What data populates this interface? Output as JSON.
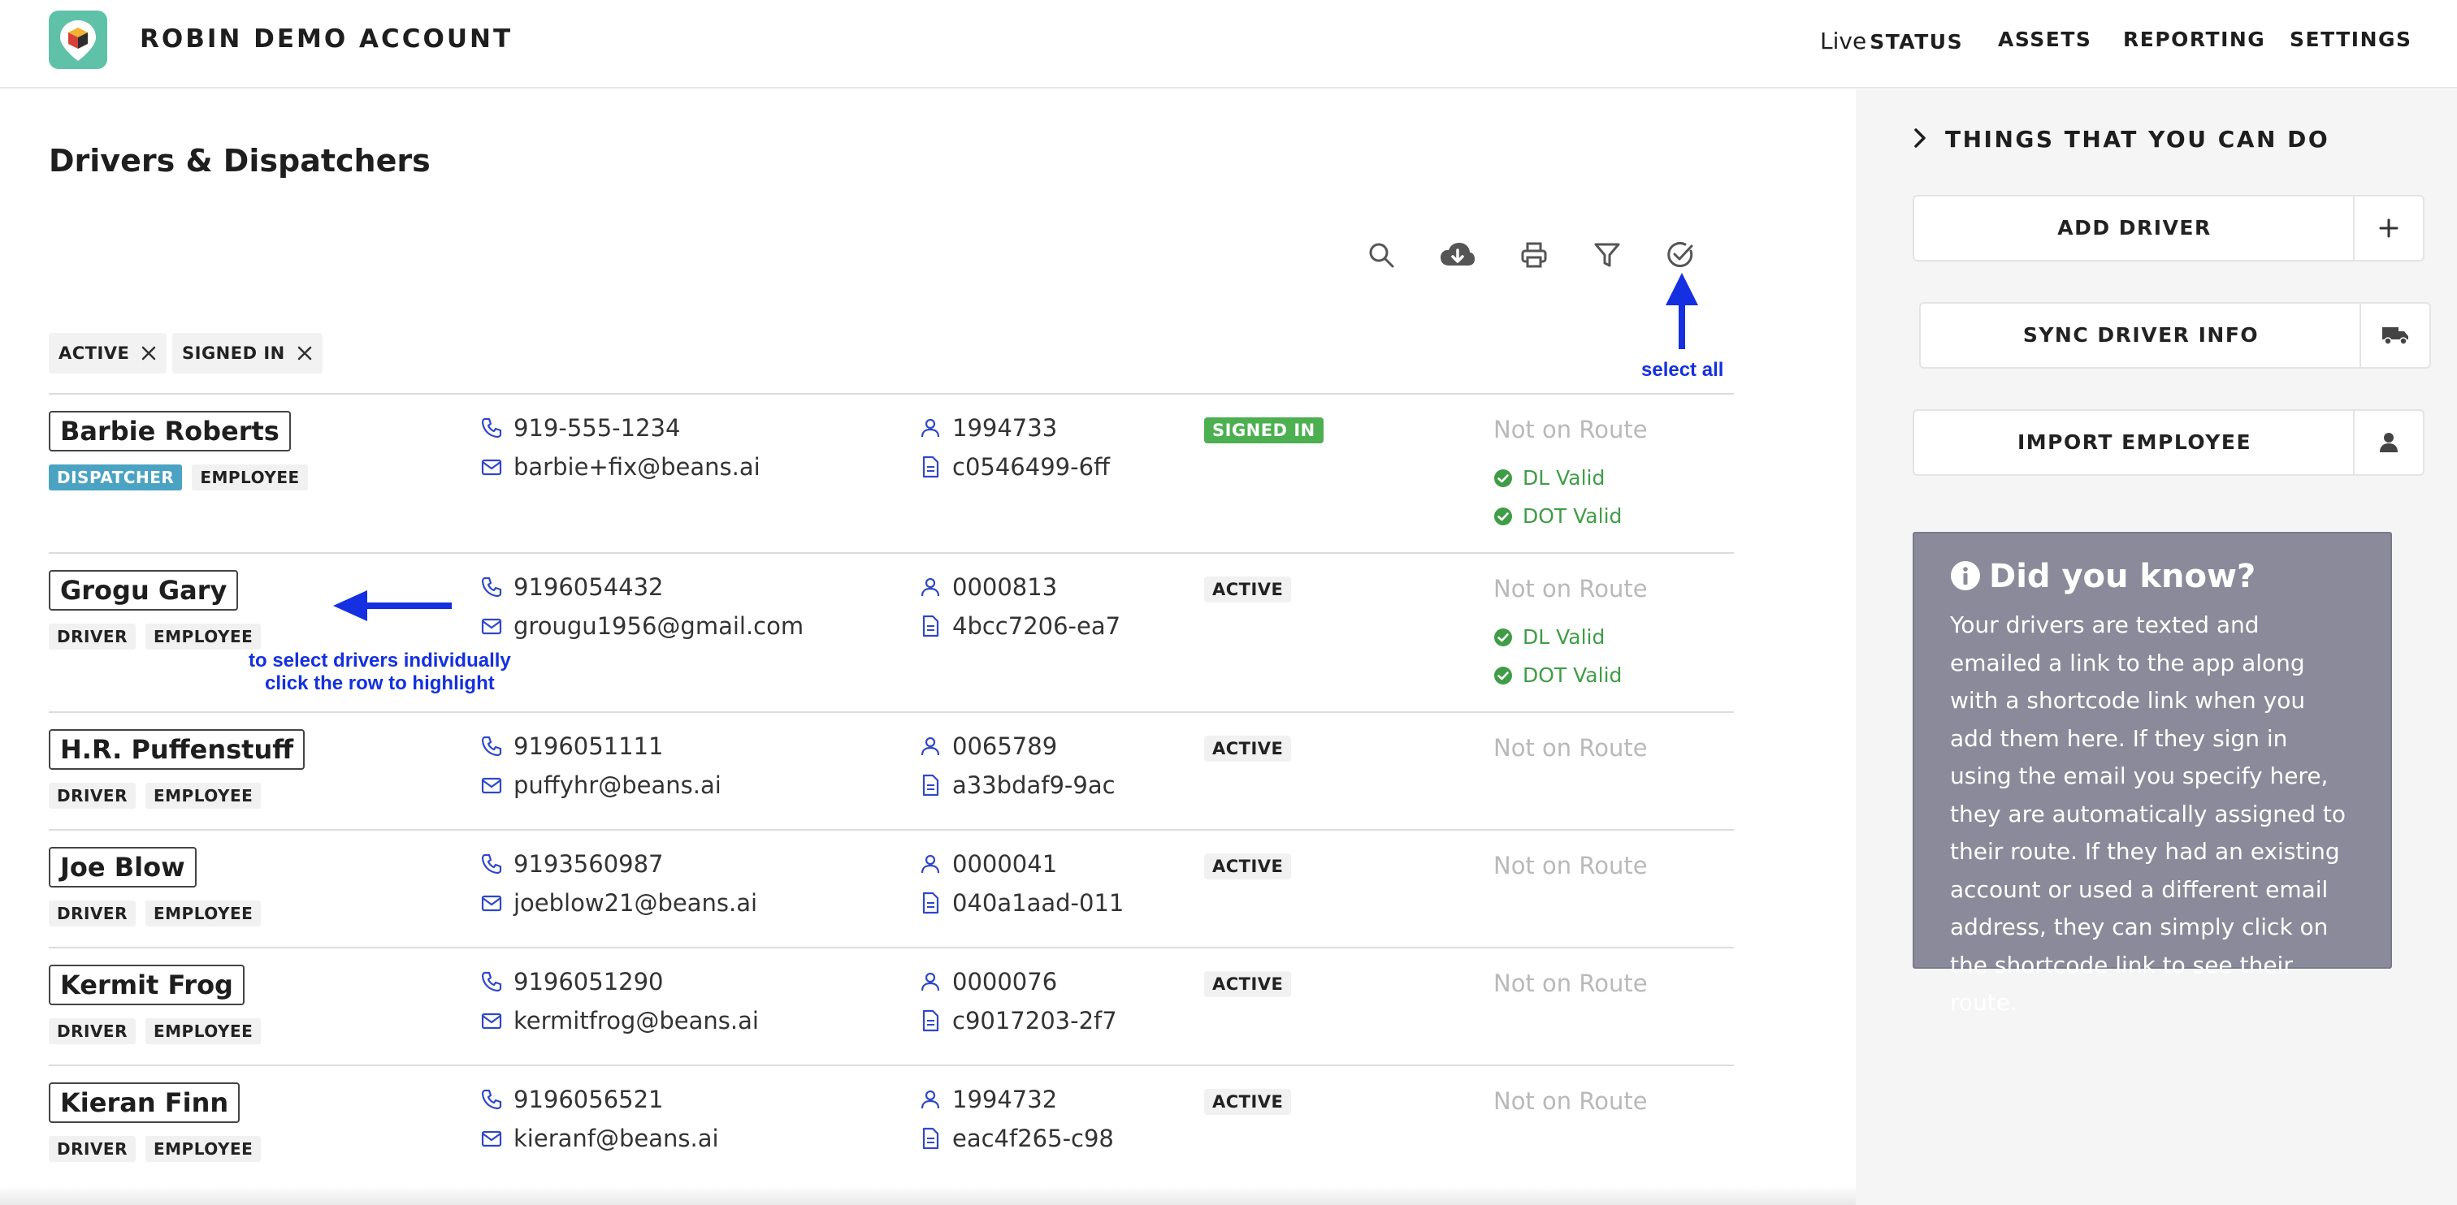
{
  "header": {
    "brand": "ROBIN DEMO ACCOUNT",
    "nav": [
      {
        "prefix": "Live",
        "label": "STATUS"
      },
      {
        "prefix": "",
        "label": "ASSETS"
      },
      {
        "prefix": "",
        "label": "REPORTING"
      },
      {
        "prefix": "",
        "label": "SETTINGS"
      }
    ]
  },
  "main": {
    "title": "Drivers & Dispatchers",
    "toolbar": [
      "search-icon",
      "cloud-download-icon",
      "print-icon",
      "filter-icon",
      "check-circle-icon"
    ],
    "filters": [
      "ACTIVE",
      "SIGNED IN"
    ],
    "annotations": {
      "select_all": "select all",
      "individual_line1": "to select drivers individually",
      "individual_line2": "click the row to highlight"
    },
    "drivers": [
      {
        "name": "Barbie Roberts",
        "tags": [
          "DISPATCHER",
          "EMPLOYEE"
        ],
        "phone": "919-555-1234",
        "email": "barbie+fix@beans.ai",
        "employee_id": "1994733",
        "doc_id": "c0546499-6ff",
        "status": "SIGNED IN",
        "route": "Not on Route",
        "valid": [
          "DL Valid",
          "DOT Valid"
        ]
      },
      {
        "name": "Grogu Gary",
        "tags": [
          "DRIVER",
          "EMPLOYEE"
        ],
        "phone": "9196054432",
        "email": "grougu1956@gmail.com",
        "employee_id": "0000813",
        "doc_id": "4bcc7206-ea7",
        "status": "ACTIVE",
        "route": "Not on Route",
        "valid": [
          "DL Valid",
          "DOT Valid"
        ]
      },
      {
        "name": "H.R. Puffenstuff",
        "tags": [
          "DRIVER",
          "EMPLOYEE"
        ],
        "phone": "9196051111",
        "email": "puffyhr@beans.ai",
        "employee_id": "0065789",
        "doc_id": "a33bdaf9-9ac",
        "status": "ACTIVE",
        "route": "Not on Route",
        "valid": []
      },
      {
        "name": "Joe Blow",
        "tags": [
          "DRIVER",
          "EMPLOYEE"
        ],
        "phone": "9193560987",
        "email": "joeblow21@beans.ai",
        "employee_id": "0000041",
        "doc_id": "040a1aad-011",
        "status": "ACTIVE",
        "route": "Not on Route",
        "valid": []
      },
      {
        "name": "Kermit Frog",
        "tags": [
          "DRIVER",
          "EMPLOYEE"
        ],
        "phone": "9196051290",
        "email": "kermitfrog@beans.ai",
        "employee_id": "0000076",
        "doc_id": "c9017203-2f7",
        "status": "ACTIVE",
        "route": "Not on Route",
        "valid": []
      },
      {
        "name": "Kieran Finn",
        "tags": [
          "DRIVER",
          "EMPLOYEE"
        ],
        "phone": "9196056521",
        "email": "kieranf@beans.ai",
        "employee_id": "1994732",
        "doc_id": "eac4f265-c98",
        "status": "ACTIVE",
        "route": "Not on Route",
        "valid": []
      }
    ]
  },
  "sidebar": {
    "heading": "THINGS THAT YOU CAN DO",
    "buttons": [
      {
        "label": "ADD DRIVER",
        "icon": "plus-icon"
      },
      {
        "label": "SYNC DRIVER INFO",
        "icon": "truck-icon"
      },
      {
        "label": "IMPORT EMPLOYEE",
        "icon": "user-icon"
      }
    ],
    "did_you_know": {
      "title": "Did you know?",
      "text": "Your drivers are texted and emailed a link to the app along with a shortcode link when you add them here. If they sign in using the email you specify here, they are automatically assigned to their route. If they had an existing account or used a different email address, they can simply click on the shortcode link to see their route."
    }
  },
  "colors": {
    "accent_blue": "#2f47c9",
    "annotation_blue": "#1430e0",
    "signed_in_green": "#4caf50",
    "valid_green": "#3f9d46",
    "dispatcher_tag": "#4aa3c2",
    "logo_green": "#5fc2a8",
    "did_you_know_bg": "#8a8a9a"
  }
}
